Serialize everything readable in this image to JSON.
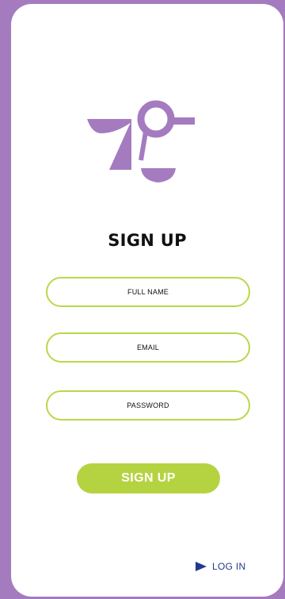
{
  "logo": {
    "icon": "bird-geometric-logo",
    "color": "#a57bbf"
  },
  "title": "SIGN UP",
  "form": {
    "full_name_placeholder": "FULL NAME",
    "email_placeholder": "EMAIL",
    "password_placeholder": "PASSWORD",
    "submit_label": "SIGN UP"
  },
  "login": {
    "label": "LOG IN",
    "icon": "play-arrow-icon"
  },
  "colors": {
    "background": "#a57bbf",
    "accent": "#b5d341",
    "link": "#223a8a",
    "card": "#ffffff"
  }
}
